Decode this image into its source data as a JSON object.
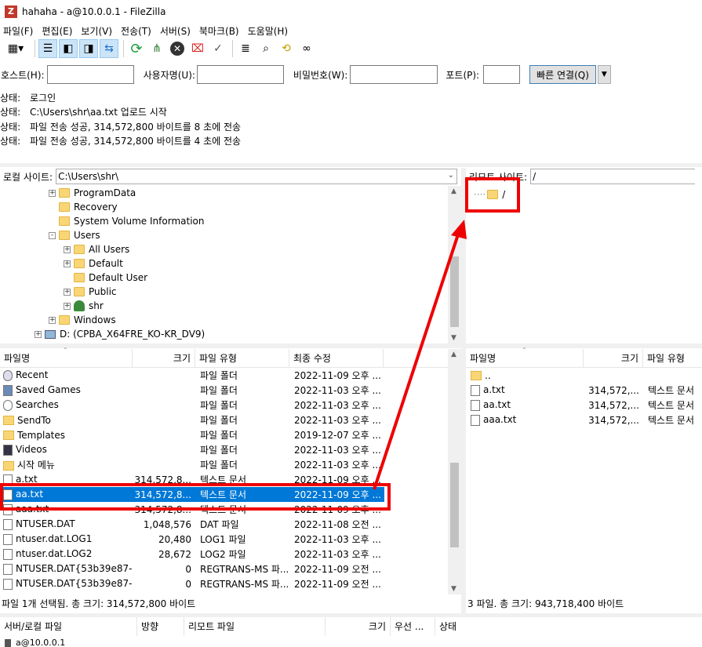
{
  "window": {
    "title": "hahaha - a@10.0.0.1 - FileZilla",
    "app_icon": "Z"
  },
  "menu": [
    "파일(F)",
    "편집(E)",
    "보기(V)",
    "전송(T)",
    "서버(S)",
    "북마크(B)",
    "도움말(H)"
  ],
  "quickconnect": {
    "host_label": "호스트(H):",
    "host_value": "",
    "user_label": "사용자명(U):",
    "user_value": "",
    "pass_label": "비밀번호(W):",
    "pass_value": "",
    "port_label": "포트(P):",
    "port_value": "",
    "connect_label": "빠른 연결(Q)"
  },
  "log": [
    {
      "label": "상태:",
      "text": "로그인"
    },
    {
      "label": "상태:",
      "text": "C:\\Users\\shr\\aa.txt 업로드 시작"
    },
    {
      "label": "상태:",
      "text": "파일 전송 성공, 314,572,800 바이트를 8 초에 전송"
    },
    {
      "label": "상태:",
      "text": "파일 전송 성공, 314,572,800 바이트를 4 초에 전송"
    }
  ],
  "local": {
    "site_label": "로컬 사이트:",
    "path": "C:\\Users\\shr\\",
    "tree": [
      {
        "label": "ProgramData",
        "expander": "+"
      },
      {
        "label": "Recovery",
        "expander": ""
      },
      {
        "label": "System Volume Information",
        "expander": ""
      },
      {
        "label": "Users",
        "expander": "-"
      },
      {
        "label": "All Users",
        "expander": "+"
      },
      {
        "label": "Default",
        "expander": "+"
      },
      {
        "label": "Default User",
        "expander": ""
      },
      {
        "label": "Public",
        "expander": "+"
      },
      {
        "label": "shr",
        "expander": "+"
      },
      {
        "label": "Windows",
        "expander": "+"
      },
      {
        "label": "D: (CPBA_X64FRE_KO-KR_DV9)",
        "expander": "+"
      }
    ],
    "columns": [
      "파일명",
      "크기",
      "파일 유형",
      "최종 수정"
    ],
    "files": [
      {
        "name": "Recent",
        "size": "",
        "type": "파일 폴더",
        "modified": "2022-11-09 오후 ...",
        "icon": "recent"
      },
      {
        "name": "Saved Games",
        "size": "",
        "type": "파일 폴더",
        "modified": "2022-11-03 오후 ...",
        "icon": "games"
      },
      {
        "name": "Searches",
        "size": "",
        "type": "파일 폴더",
        "modified": "2022-11-03 오후 ...",
        "icon": "search"
      },
      {
        "name": "SendTo",
        "size": "",
        "type": "파일 폴더",
        "modified": "2022-11-03 오후 ...",
        "icon": "folder"
      },
      {
        "name": "Templates",
        "size": "",
        "type": "파일 폴더",
        "modified": "2019-12-07 오후 ...",
        "icon": "folder"
      },
      {
        "name": "Videos",
        "size": "",
        "type": "파일 폴더",
        "modified": "2022-11-03 오후 ...",
        "icon": "video"
      },
      {
        "name": "시작 메뉴",
        "size": "",
        "type": "파일 폴더",
        "modified": "2022-11-03 오후 ...",
        "icon": "folder"
      },
      {
        "name": "a.txt",
        "size": "314,572,8...",
        "type": "텍스트 문서",
        "modified": "2022-11-09 오후 ...",
        "icon": "file"
      },
      {
        "name": "aa.txt",
        "size": "314,572,8...",
        "type": "텍스트 문서",
        "modified": "2022-11-09 오후 ...",
        "icon": "file",
        "selected": true
      },
      {
        "name": "aaa.txt",
        "size": "314,572,8...",
        "type": "텍스트 문서",
        "modified": "2022-11-09 오후 ...",
        "icon": "file"
      },
      {
        "name": "NTUSER.DAT",
        "size": "1,048,576",
        "type": "DAT 파일",
        "modified": "2022-11-08 오전 ...",
        "icon": "file"
      },
      {
        "name": "ntuser.dat.LOG1",
        "size": "20,480",
        "type": "LOG1 파일",
        "modified": "2022-11-03 오후 ...",
        "icon": "file"
      },
      {
        "name": "ntuser.dat.LOG2",
        "size": "28,672",
        "type": "LOG2 파일",
        "modified": "2022-11-03 오후 ...",
        "icon": "file"
      },
      {
        "name": "NTUSER.DAT{53b39e87-...",
        "size": "0",
        "type": "REGTRANS-MS 파...",
        "modified": "2022-11-09 오전 ...",
        "icon": "file"
      },
      {
        "name": "NTUSER.DAT{53b39e87-...",
        "size": "0",
        "type": "REGTRANS-MS 파...",
        "modified": "2022-11-09 오전 ...",
        "icon": "file"
      }
    ],
    "status": "파일 1개 선택됨. 총 크기: 314,572,800 바이트"
  },
  "remote": {
    "site_label": "리모트 사이트:",
    "path": "/",
    "tree_root": "/",
    "columns": [
      "파일명",
      "크기",
      "파일 유형"
    ],
    "files": [
      {
        "name": "..",
        "size": "",
        "type": "",
        "icon": "folder"
      },
      {
        "name": "a.txt",
        "size": "314,572,...",
        "type": "텍스트 문서",
        "icon": "file"
      },
      {
        "name": "aa.txt",
        "size": "314,572,...",
        "type": "텍스트 문서",
        "icon": "file"
      },
      {
        "name": "aaa.txt",
        "size": "314,572,...",
        "type": "텍스트 문서",
        "icon": "file"
      }
    ],
    "status": "3 파일. 총 크기: 943,718,400 바이트"
  },
  "queue": {
    "columns": [
      "서버/로컬 파일",
      "방향",
      "리모트 파일",
      "크기",
      "우선 ...",
      "상태"
    ],
    "first_row": "a@10.0.0.1"
  },
  "colors": {
    "selection": "#0078d7",
    "highlight": "#e00000"
  }
}
